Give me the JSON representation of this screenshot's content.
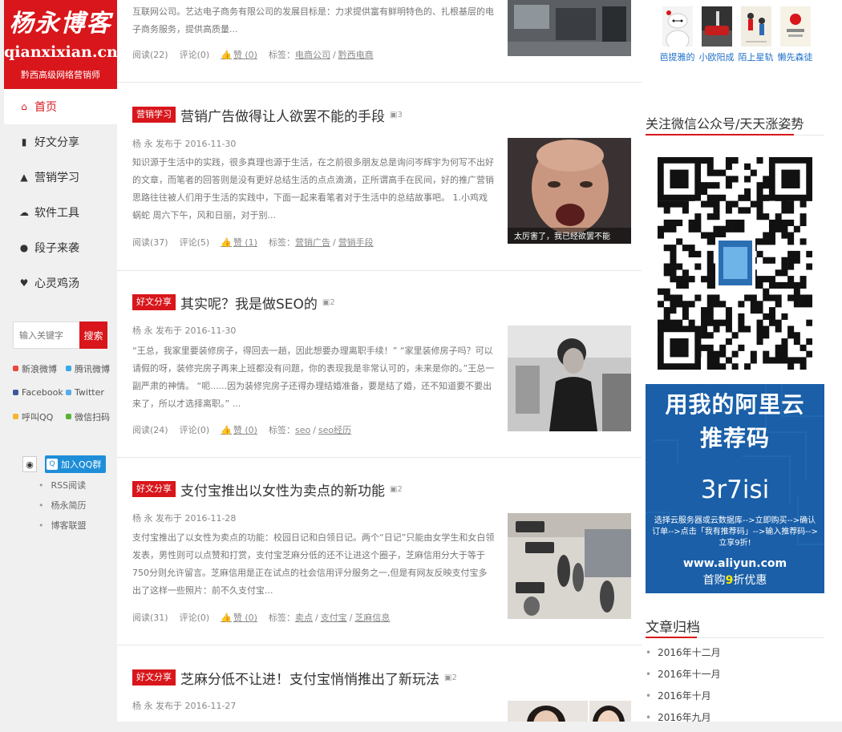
{
  "logo": {
    "brand": "杨永博客",
    "domain": "qianxixian.cn",
    "tagline": "黔西高级网络营销师"
  },
  "nav": [
    {
      "label": "首页",
      "icon": "home-icon",
      "glyph": "⌂"
    },
    {
      "label": "好文分享",
      "icon": "book-icon",
      "glyph": "▮"
    },
    {
      "label": "营销学习",
      "icon": "graduation-cap-icon",
      "glyph": "▲"
    },
    {
      "label": "软件工具",
      "icon": "cloud-download-icon",
      "glyph": "☁"
    },
    {
      "label": "段子来袭",
      "icon": "chat-bubble-icon",
      "glyph": "●"
    },
    {
      "label": "心灵鸡汤",
      "icon": "heart-icon",
      "glyph": "♥"
    }
  ],
  "search": {
    "placeholder": "输入关键字",
    "button": "搜索"
  },
  "social": [
    {
      "label": "新浪微博",
      "color": "#e8473d"
    },
    {
      "label": "腾讯微博",
      "color": "#3aa7e6"
    },
    {
      "label": "Facebook",
      "color": "#3b5998"
    },
    {
      "label": "Twitter",
      "color": "#55acee"
    },
    {
      "label": "呼叫QQ",
      "color": "#f5b731"
    },
    {
      "label": "微信扫码",
      "color": "#56b535"
    }
  ],
  "qq": {
    "join": "加入QQ群"
  },
  "side_links": [
    "RSS阅读",
    "杨永简历",
    "博客联盟"
  ],
  "posts": [
    {
      "excerpt": "互联网公司。艺达电子商务有限公司的发展目标是：力求提供富有鲜明特色的、扎根基层的电子商务服务，提供高质量...",
      "views": "阅读(22)",
      "comments": "评论(0)",
      "likes": "赞 (0)",
      "tags_label": "标签：",
      "tags": [
        "电商公司",
        "黔西电商"
      ]
    },
    {
      "category": "营销学习",
      "title": "营销广告做得让人欲罢不能的手段",
      "img_count": "3",
      "meta": "杨 永 发布于 2016-11-30",
      "excerpt": "知识源于生活中的实践，很多真理也源于生活，在之前很多朋友总是询问岑辉宇为何写不出好的文章，而笔者的回答则是没有更好总结生活的点点滴滴，正所谓高手在民间，好的推广营销思路往往被人们用于生活的实践中，下面一起来看笔者对于生活中的总结故事吧。 1.小鸡戏蜗蛇 周六下午，风和日丽，对于别...",
      "views": "阅读(37)",
      "comments": "评论(5)",
      "likes": "赞 (1)",
      "tags_label": "标签：",
      "tags": [
        "营销广告",
        "营销手段"
      ],
      "thumb_caption": "太厉害了，我已经欲罢不能"
    },
    {
      "category": "好文分享",
      "title": "其实呢？我是做SEO的",
      "img_count": "2",
      "meta": "杨 永 发布于 2016-11-30",
      "excerpt": "“王总，我家里要装修房子，得回去一趟，因此想要办理离职手续！” “家里装修房子吗？可以请假的呀，装修完房子再来上班都没有问题，你的表现我是非常认可的，未来是你的。”王总一副严肃的神情。 “呃......因为装修完房子还得办理结婚准备，要是结了婚，还不知道要不要出来了，所以才选择离职。” ...",
      "views": "阅读(24)",
      "comments": "评论(0)",
      "likes": "赞 (0)",
      "tags_label": "标签：",
      "tags": [
        "seo",
        "seo经历"
      ]
    },
    {
      "category": "好文分享",
      "title": "支付宝推出以女性为卖点的新功能",
      "img_count": "2",
      "meta": "杨 永 发布于 2016-11-28",
      "excerpt": "支付宝推出了以女性为卖点的功能：校园日记和白领日记。两个“日记”只能由女学生和女白领发表，男性则可以点赞和打赏，支付宝芝麻分低的还不让进这个圈子，芝麻信用分大于等于750分则允许留言。芝麻信用是正在试点的社会信用评分服务之一,但是有网友反映支付宝多出了这样一些照片：前不久支付宝...",
      "views": "阅读(31)",
      "comments": "评论(0)",
      "likes": "赞 (0)",
      "tags_label": "标签：",
      "tags": [
        "卖点",
        "支付宝",
        "芝麻信息"
      ]
    },
    {
      "category": "好文分享",
      "title": "芝麻分低不让进！支付宝悄悄推出了新玩法",
      "img_count": "2",
      "meta": "杨 永 发布于 2016-11-27"
    }
  ],
  "right": {
    "avatars": [
      {
        "name": "芭提雅的",
        "icon": "baymax-avatar-icon"
      },
      {
        "name": "小欧阳成",
        "icon": "car-avatar-icon"
      },
      {
        "name": "陌上星轨",
        "icon": "figure-avatar-icon"
      },
      {
        "name": "懒先森徒",
        "icon": "logo-avatar-icon"
      }
    ],
    "wechat_title": "关注微信公众号/天天涨姿势",
    "promo": {
      "line1": "用我的阿里云",
      "line2": "推荐码",
      "code": "3r7isi",
      "hint": "选择云服务器或云数据库-->立即购买-->确认订单-->点击「我有推荐码」-->输入推荐码-->立享9折!",
      "url": "www.aliyun.com",
      "disc_pre": "首购",
      "disc_num": "9",
      "disc_post": "折优惠"
    },
    "archive_title": "文章归档",
    "archive": [
      "2016年十二月",
      "2016年十一月",
      "2016年十月",
      "2016年九月"
    ]
  }
}
